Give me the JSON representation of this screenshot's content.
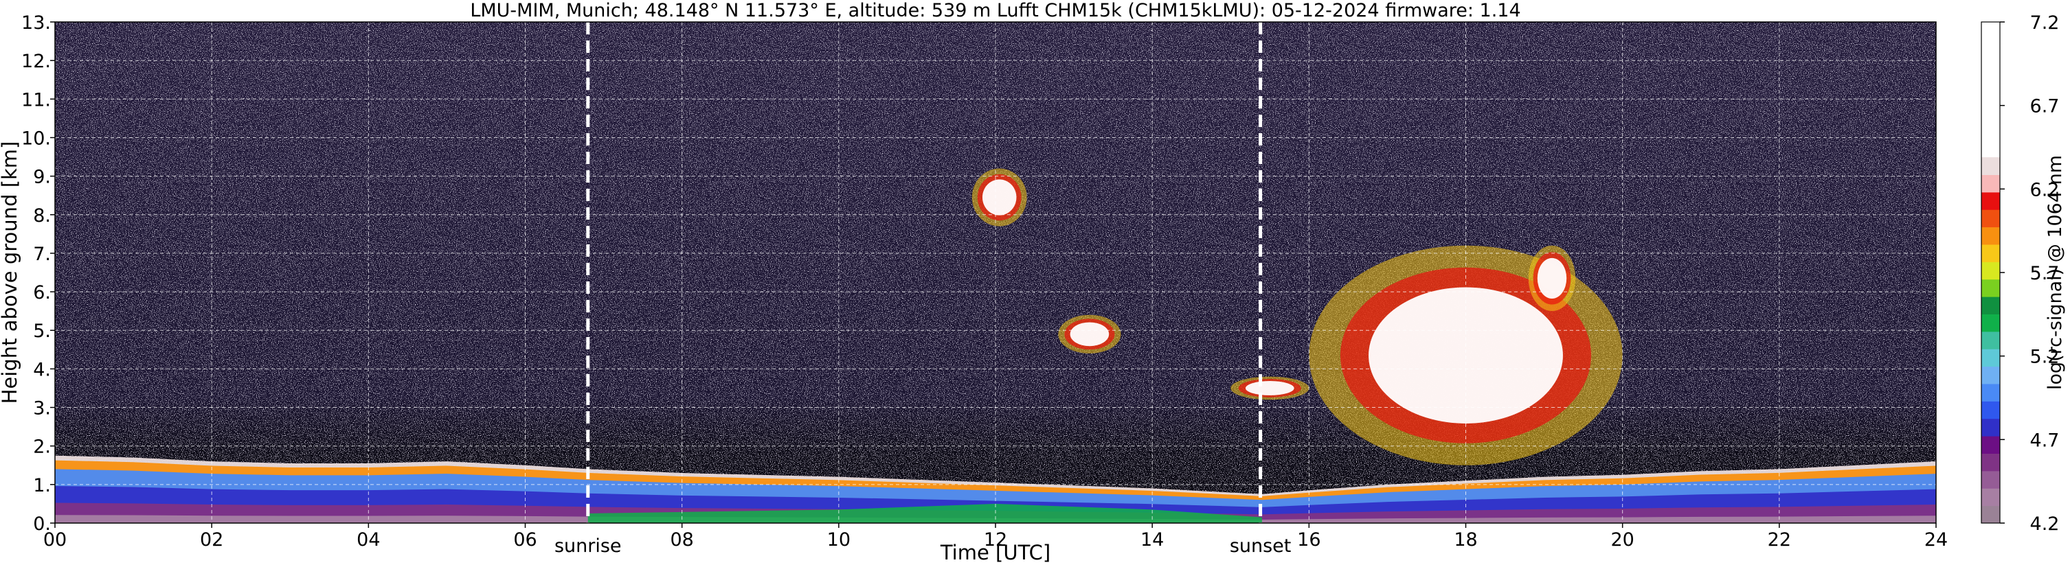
{
  "chart_data": {
    "type": "heatmap",
    "title": "LMU-MIM, Munich; 48.148° N 11.573° E, altitude: 539 m    Lufft CHM15k (CHM15kLMU): 05-12-2024    firmware: 1.14",
    "xlabel": "Time [UTC]",
    "ylabel": "Height above ground [km]",
    "xlim": [
      0,
      24
    ],
    "ylim": [
      0,
      13
    ],
    "x_ticks": [
      "00",
      "02",
      "04",
      "06",
      "08",
      "10",
      "12",
      "14",
      "16",
      "18",
      "20",
      "22",
      "24"
    ],
    "y_ticks": [
      "0.",
      "1.",
      "2.",
      "3.",
      "4.",
      "5.",
      "6.",
      "7.",
      "8.",
      "9.",
      "10.",
      "11.",
      "12.",
      "13."
    ],
    "grid": true,
    "colorbar": {
      "label": "log(rc-signal) @ 1064 nm",
      "range": [
        4.2,
        7.2
      ],
      "ticks": [
        "4.2",
        "4.7",
        "5.2",
        "5.7",
        "6.2",
        "6.7",
        "7.2"
      ],
      "colors": [
        "#9a8296",
        "#a77fa3",
        "#955c96",
        "#7f3385",
        "#6c0f84",
        "#3030c8",
        "#2f58ee",
        "#4a8af5",
        "#6fb0f3",
        "#5ec9d8",
        "#3fbfa0",
        "#10b04a",
        "#109040",
        "#7ad020",
        "#d8e820",
        "#f8c818",
        "#f89010",
        "#f05010",
        "#e81010",
        "#f8b8b8",
        "#ecdede",
        "#ffffff"
      ]
    },
    "vertical_markers": [
      {
        "label": "sunrise",
        "x": 6.8
      },
      {
        "label": "sunset",
        "x": 15.38
      }
    ],
    "features": [
      {
        "kind": "boundary_layer_top",
        "x": [
          0,
          1,
          2,
          3,
          4,
          5,
          6,
          6.8,
          8,
          10,
          12,
          14,
          15.4,
          16,
          17,
          18,
          19,
          20,
          21,
          22,
          23,
          24
        ],
        "y": [
          1.75,
          1.7,
          1.6,
          1.55,
          1.55,
          1.6,
          1.5,
          1.4,
          1.3,
          1.2,
          1.05,
          0.9,
          0.75,
          0.85,
          1.0,
          1.1,
          1.2,
          1.25,
          1.35,
          1.4,
          1.5,
          1.6
        ]
      },
      {
        "kind": "cloud",
        "x": [
          12.8,
          13.6
        ],
        "y": [
          4.4,
          5.4
        ]
      },
      {
        "kind": "cloud",
        "x": [
          11.7,
          12.4
        ],
        "y": [
          7.7,
          9.2
        ]
      },
      {
        "kind": "cloud",
        "x": [
          15.0,
          16.0
        ],
        "y": [
          3.2,
          3.8
        ]
      },
      {
        "kind": "cloud",
        "x": [
          16.0,
          20.0
        ],
        "y": [
          1.5,
          7.2
        ]
      },
      {
        "kind": "cloud",
        "x": [
          18.8,
          19.4
        ],
        "y": [
          5.5,
          7.2
        ]
      }
    ]
  }
}
